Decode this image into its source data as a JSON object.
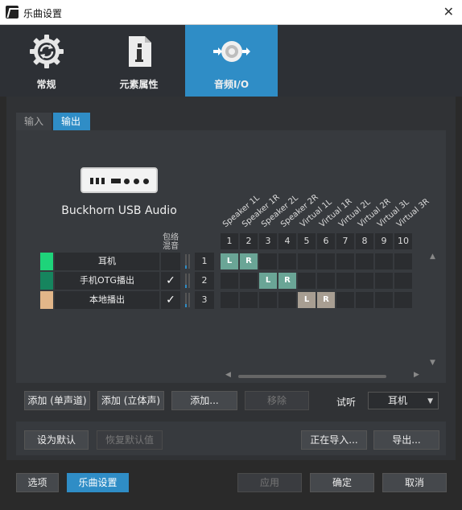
{
  "window": {
    "title": "乐曲设置",
    "close_glyph": "✕"
  },
  "nav": [
    {
      "label": "常规",
      "icon": "gear-refresh-icon",
      "active": false
    },
    {
      "label": "元素属性",
      "icon": "document-info-icon",
      "active": false
    },
    {
      "label": "音频I/O",
      "icon": "audio-io-icon",
      "active": true
    }
  ],
  "tabs": {
    "input": "输入",
    "output": "输出"
  },
  "device": {
    "name": "Buckhorn USB Audio",
    "icon": "audio-interface-icon"
  },
  "matrix": {
    "combine_header": "包络\n混音",
    "speakers": [
      "Speaker 1L",
      "Speaker 1R",
      "Speaker 2L",
      "Speaker 2R",
      "Virtual 1L",
      "Virtual 1R",
      "Virtual 2L",
      "Virtual 2R",
      "Virtual 3L",
      "Virtual 3R"
    ],
    "columns": [
      "1",
      "2",
      "3",
      "4",
      "5",
      "6",
      "7",
      "8",
      "9",
      "10"
    ],
    "rows": [
      {
        "name": "耳机",
        "color": "#1ed47a",
        "checked": false,
        "index": "1",
        "assign": {
          "0": "L",
          "1": "R"
        },
        "tone": "teal"
      },
      {
        "name": "手机OTG播出",
        "color": "#16855e",
        "checked": true,
        "index": "2",
        "assign": {
          "2": "L",
          "3": "R"
        },
        "tone": "teal"
      },
      {
        "name": "本地播出",
        "color": "#e2b689",
        "checked": true,
        "index": "3",
        "assign": {
          "4": "L",
          "5": "R"
        },
        "tone": "sand"
      }
    ],
    "check_glyph": "✓"
  },
  "buttons": {
    "add_mono": "添加 (单声道)",
    "add_stereo": "添加 (立体声)",
    "add_more": "添加...",
    "remove": "移除",
    "listen_label": "试听",
    "listen_value": "耳机",
    "set_default": "设为默认",
    "restore_default": "恢复默认值",
    "importing": "正在导入...",
    "export": "导出...",
    "options": "选项",
    "song_settings": "乐曲设置",
    "apply": "应用",
    "ok": "确定",
    "cancel": "取消"
  }
}
